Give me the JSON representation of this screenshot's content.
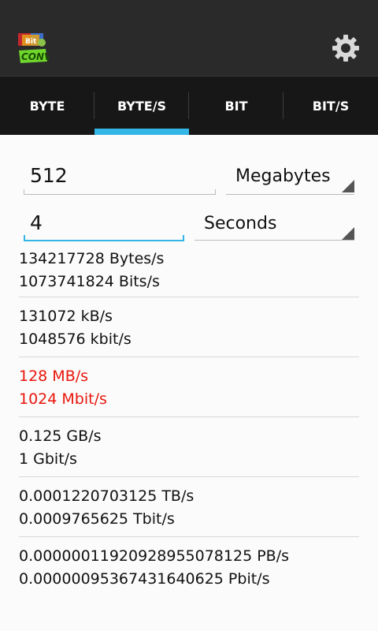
{
  "tabs": [
    {
      "label": "BYTE",
      "selected": false
    },
    {
      "label": "BYTE/S",
      "selected": true
    },
    {
      "label": "BIT",
      "selected": false
    },
    {
      "label": "BIT/S",
      "selected": false
    }
  ],
  "amount": {
    "value": "512",
    "unit": "Megabytes"
  },
  "time": {
    "value": "4",
    "unit": "Seconds"
  },
  "results": [
    {
      "line1": "134217728 Bytes/s",
      "line2": "1073741824 Bits/s",
      "highlight": false
    },
    {
      "line1": "131072 kB/s",
      "line2": "1048576 kbit/s",
      "highlight": false
    },
    {
      "line1": "128 MB/s",
      "line2": "1024 Mbit/s",
      "highlight": true
    },
    {
      "line1": "0.125 GB/s",
      "line2": "1 Gbit/s",
      "highlight": false
    },
    {
      "line1": "0.0001220703125 TB/s",
      "line2": "0.0009765625 Tbit/s",
      "highlight": false
    },
    {
      "line1": "0.00000011920928955078125 PB/s",
      "line2": "0.00000095367431640625 Pbit/s",
      "highlight": false
    }
  ],
  "colors": {
    "accent": "#33b5e5",
    "highlight": "#e8160c",
    "actionbar": "#2a2a2a",
    "tabbar": "#171717"
  },
  "icons": {
    "app": "bit-conv-app-icon",
    "settings": "gear-icon"
  }
}
